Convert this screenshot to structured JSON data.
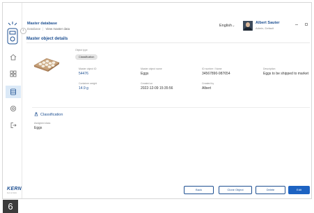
{
  "app": {
    "title": "Master database",
    "breadcrumb": [
      "Database",
      "View master data"
    ],
    "language": "English",
    "user": {
      "name": "Albert Sauter",
      "role": "Admin, Default"
    },
    "brand": "KERN",
    "brand_sub": "Kern & Sohn"
  },
  "sidebar": {
    "items": [
      {
        "icon": "home-icon",
        "active": false
      },
      {
        "icon": "grid-icon",
        "active": false
      },
      {
        "icon": "database-icon",
        "active": true
      },
      {
        "icon": "settings-icon",
        "active": false
      },
      {
        "icon": "logout-icon",
        "active": false
      }
    ]
  },
  "page": {
    "title": "Master object details",
    "object_type_label": "Object type",
    "object_type": "Classification",
    "fields": [
      {
        "label": "Master object ID",
        "value": "54476",
        "blue": true
      },
      {
        "label": "Master object name",
        "value": "Eggs",
        "blue": false
      },
      {
        "label": "ID number / Name",
        "value": "34567890-987654",
        "blue": false
      },
      {
        "label": "Description",
        "value": "Eggs to be shipped to market",
        "blue": false
      },
      {
        "label": "Container weight",
        "value": "14.9 g",
        "blue": true
      },
      {
        "label": "Created on",
        "value": "2022-12-09 15:35:56",
        "blue": false
      },
      {
        "label": "Created by",
        "value": "Albert",
        "blue": false
      }
    ],
    "classification": {
      "title": "Classification",
      "assigned_label": "Assigned class",
      "assigned_value": "Eggs"
    }
  },
  "buttons": {
    "back": "Back",
    "clone": "Clone Object",
    "delete": "Delete",
    "edit": "Edit"
  },
  "step": "6",
  "colors": {
    "accent": "#1d4f91",
    "primary": "#1d63c2"
  }
}
